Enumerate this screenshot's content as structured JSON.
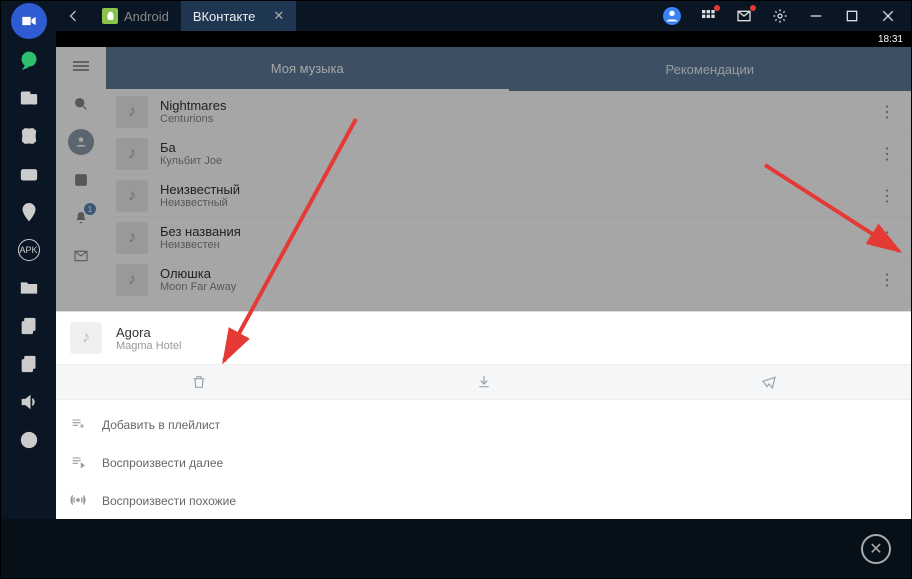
{
  "titlebar": {
    "tabs": [
      {
        "label": "Android",
        "active": false
      },
      {
        "label": "ВКонтакте",
        "active": true
      }
    ]
  },
  "status": {
    "time": "18:31"
  },
  "vk": {
    "tabs": {
      "my_music": "Моя музыка",
      "recommend": "Рекомендации"
    },
    "notif_count": "1"
  },
  "tracks": [
    {
      "title": "Nightmares",
      "artist": "Centurions"
    },
    {
      "title": "Ба",
      "artist": "Кульбит Joe"
    },
    {
      "title": "Неизвестный",
      "artist": "Неизвестный"
    },
    {
      "title": "Без названия",
      "artist": "Неизвестен"
    },
    {
      "title": "Олюшка",
      "artist": "Moon Far Away"
    }
  ],
  "sheet": {
    "title": "Agora",
    "artist": "Magma Hotel",
    "items": {
      "add_playlist": "Добавить в плейлист",
      "play_next": "Воспроизвести далее",
      "play_similar": "Воспроизвести похожие"
    }
  },
  "colors": {
    "accent": "#e53935"
  }
}
